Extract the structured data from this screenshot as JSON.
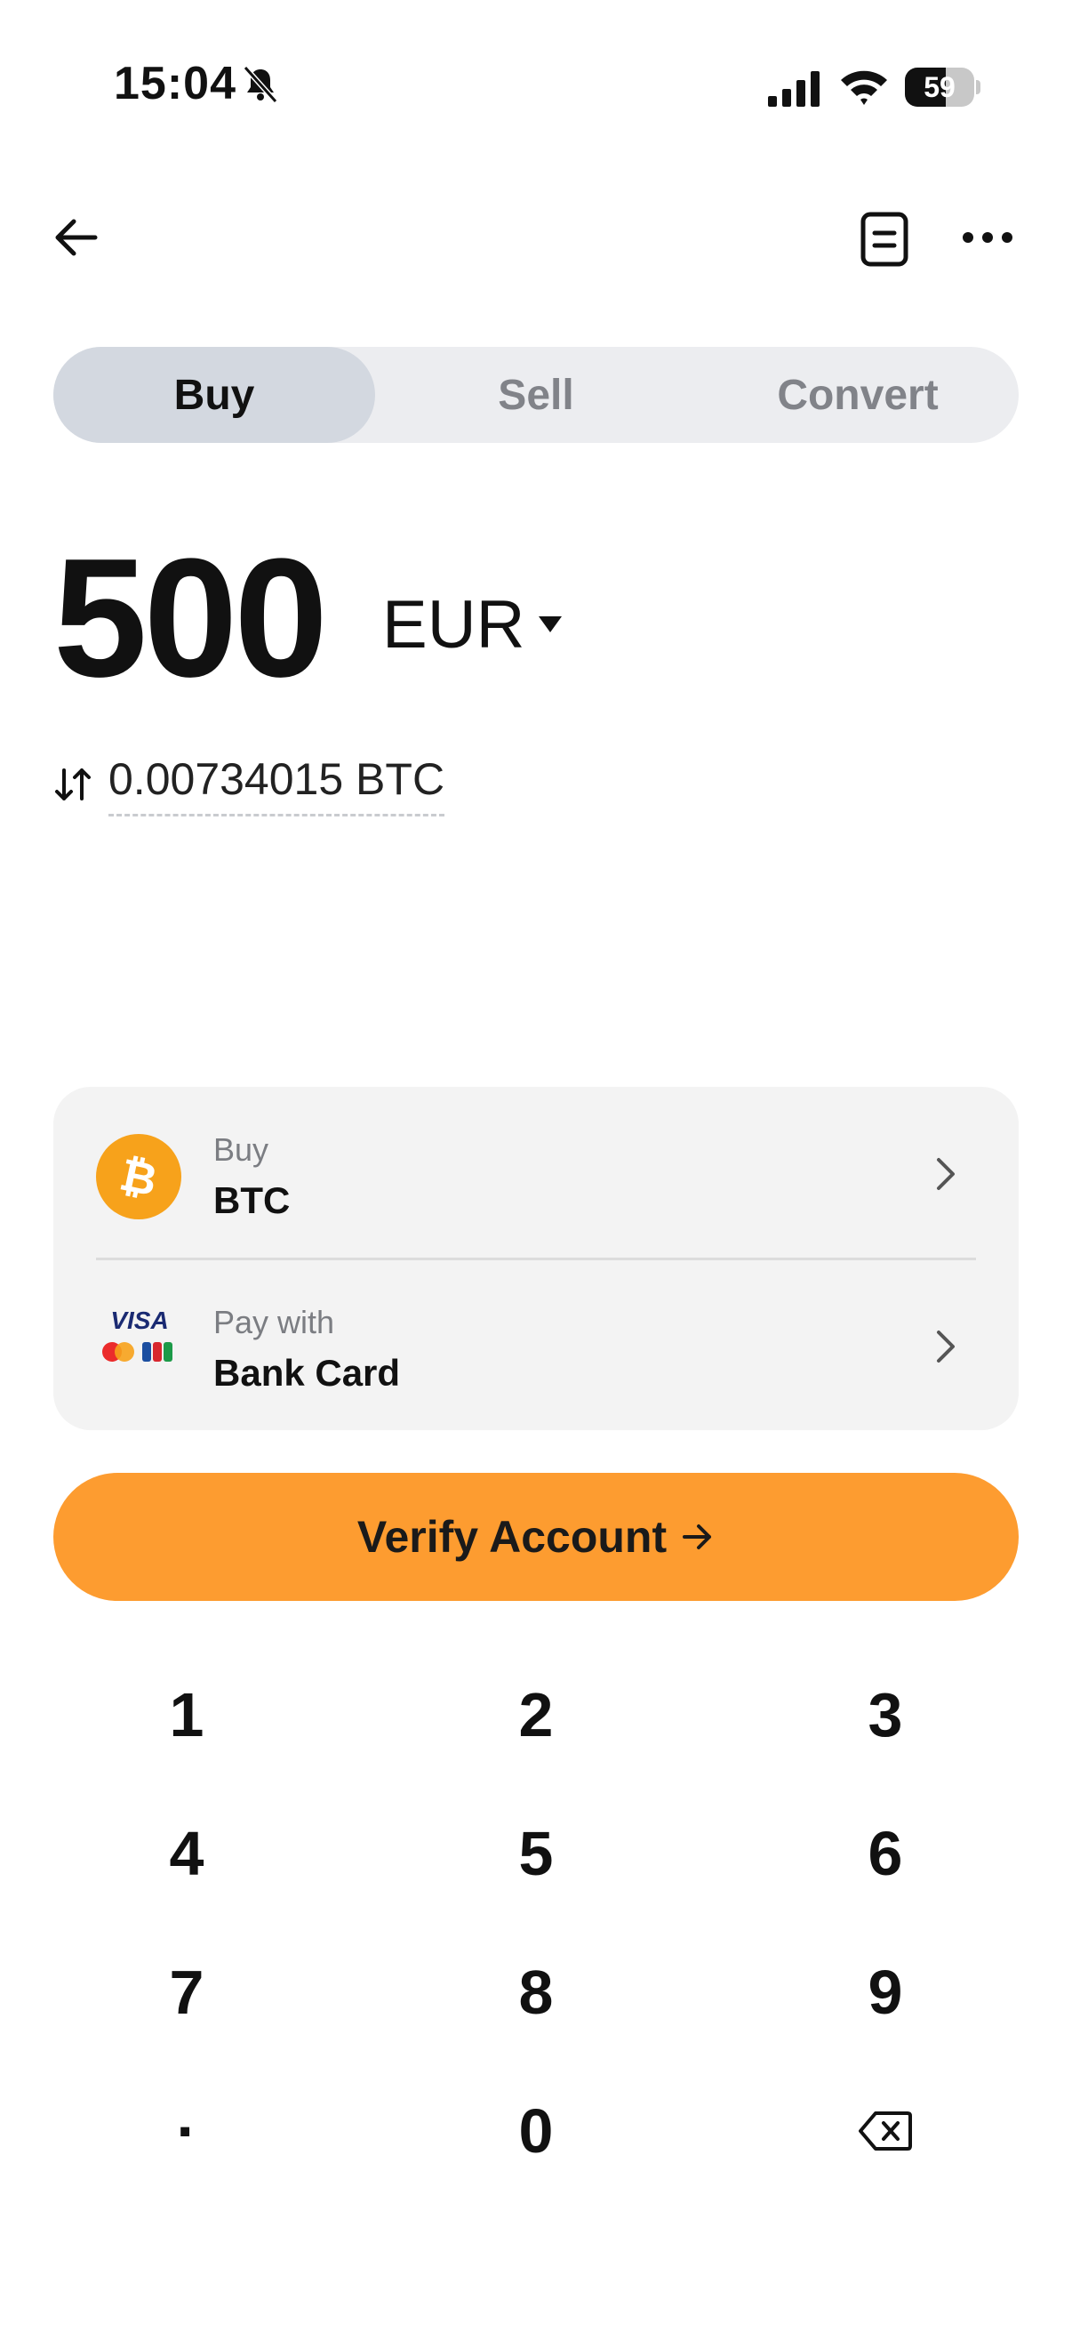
{
  "status_bar": {
    "time": "15:04",
    "battery_percent": "59",
    "battery_level": 0.59
  },
  "icons": {
    "back": "arrow-left-icon",
    "receipt": "receipt-icon",
    "more": "more-horizontal-icon"
  },
  "tabs": [
    {
      "label": "Buy",
      "active": true
    },
    {
      "label": "Sell",
      "active": false
    },
    {
      "label": "Convert",
      "active": false
    }
  ],
  "amount": {
    "value": "500",
    "currency": "EUR",
    "converted": "0.00734015 BTC"
  },
  "asset_row": {
    "label": "Buy",
    "value": "BTC",
    "icon": "bitcoin-icon"
  },
  "payment_row": {
    "label": "Pay with",
    "value": "Bank Card",
    "logo_text": "VISA",
    "icon": "card-networks-icon"
  },
  "cta": {
    "label": "Verify Account"
  },
  "keypad": {
    "keys": [
      "1",
      "2",
      "3",
      "4",
      "5",
      "6",
      "7",
      "8",
      "9",
      "·",
      "0"
    ],
    "backspace_icon": "backspace-icon"
  },
  "colors": {
    "accent": "#fd9c30",
    "bitcoin": "#f7a21b",
    "tab_active": "#d3d8e0",
    "tab_track": "#ecedf0",
    "card_bg": "#f3f3f3"
  }
}
